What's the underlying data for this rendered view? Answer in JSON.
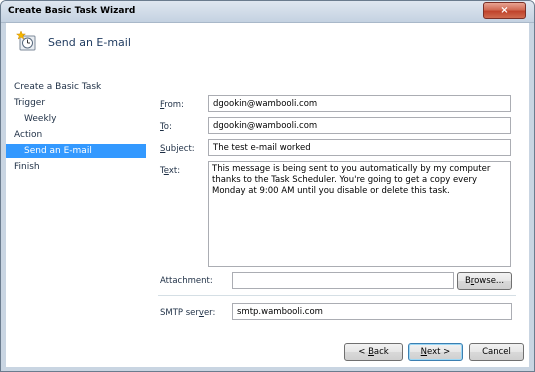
{
  "window": {
    "title": "Create Basic Task Wizard",
    "close_glyph": "×"
  },
  "header": {
    "title": "Send an E-mail",
    "icon": "task-scheduler-icon"
  },
  "nav": {
    "items": [
      {
        "label": "Create a Basic Task"
      },
      {
        "label": "Trigger"
      },
      {
        "label": "Weekly"
      },
      {
        "label": "Action"
      },
      {
        "label": "Send an E-mail"
      },
      {
        "label": "Finish"
      }
    ],
    "selected": "Send an E-mail"
  },
  "form": {
    "from": {
      "label_pre": "",
      "label_key": "F",
      "label_post": "rom:",
      "value": "dgookin@wambooli.com"
    },
    "to": {
      "label_pre": "",
      "label_key": "T",
      "label_post": "o:",
      "value": "dgookin@wambooli.com"
    },
    "subject": {
      "label_pre": "",
      "label_key": "S",
      "label_post": "ubject:",
      "value": "The test e-mail worked"
    },
    "text": {
      "label_pre": "T",
      "label_key": "e",
      "label_post": "xt:",
      "value": "This message is being sent to you automatically by my computer thanks to the Task Scheduler. You're going to get a copy every Monday at 9:00 AM until you disable or delete this task."
    },
    "attachment": {
      "label": "Attachment:",
      "value": ""
    },
    "browse": {
      "label_pre": "B",
      "label_key": "r",
      "label_post": "owse..."
    },
    "smtp": {
      "label_pre": "SMTP ser",
      "label_key": "v",
      "label_post": "er:",
      "value": "smtp.wambooli.com"
    }
  },
  "buttons": {
    "back": {
      "label_pre": "< ",
      "label_key": "B",
      "label_post": "ack"
    },
    "next": {
      "label_pre": "",
      "label_key": "N",
      "label_post": "ext >"
    },
    "cancel": {
      "label": "Cancel"
    }
  },
  "colors": {
    "selection": "#3399ff",
    "frame": "#c9d5e2",
    "title_text": "#1e3a5f"
  }
}
